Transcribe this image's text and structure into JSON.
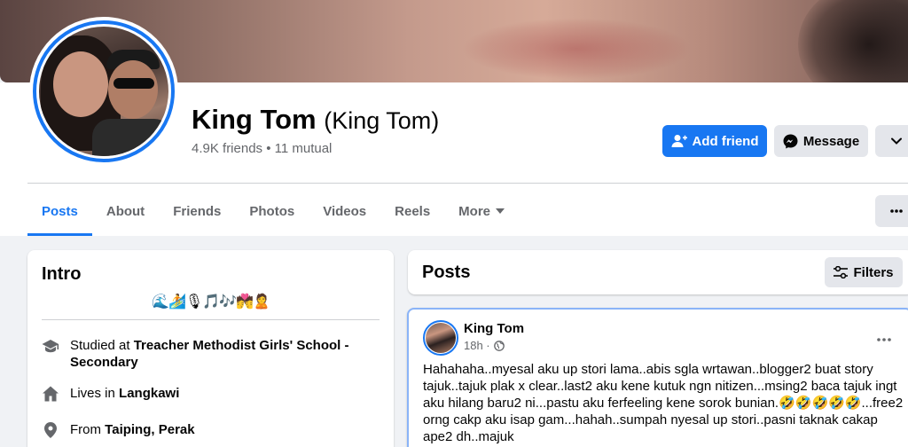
{
  "profile": {
    "name": "King Tom",
    "alt_name": "(King Tom)",
    "friends_summary": "4.9K friends • 11 mutual"
  },
  "actions": {
    "add_friend": "Add friend",
    "message": "Message"
  },
  "tabs": [
    {
      "label": "Posts",
      "active": true
    },
    {
      "label": "About"
    },
    {
      "label": "Friends"
    },
    {
      "label": "Photos"
    },
    {
      "label": "Videos"
    },
    {
      "label": "Reels"
    },
    {
      "label": "More"
    }
  ],
  "intro": {
    "title": "Intro",
    "bio": "🌊🏄🎙🎵🎶💏🙎",
    "studied_prefix": "Studied at ",
    "studied_school": "Treacher Methodist Girls' School - Secondary",
    "lives_prefix": "Lives in ",
    "lives_place": "Langkawi",
    "from_prefix": "From ",
    "from_place": "Taiping, Perak"
  },
  "posts_section": {
    "title": "Posts",
    "filters_label": "Filters"
  },
  "post": {
    "author": "King Tom",
    "time": "18h ·",
    "text": "Hahahaha..myesal aku up stori lama..abis sgla wrtawan..blogger2 buat story tajuk..tajuk plak x clear..last2 aku kene kutuk ngn nitizen...msing2 baca tajuk ingt aku hilang baru2 ni...pastu aku ferfeeling kene sorok bunian.🤣🤣🤣🤣🤣...free2 orng cakp aku isap gam...hahah..sumpah nyesal up stori..pasni taknak cakap ape2 dh..majuk"
  },
  "colors": {
    "accent": "#1877f2",
    "secondary_text": "#65676b",
    "button_gray": "#e4e6eb",
    "page_bg": "#f0f2f5"
  }
}
